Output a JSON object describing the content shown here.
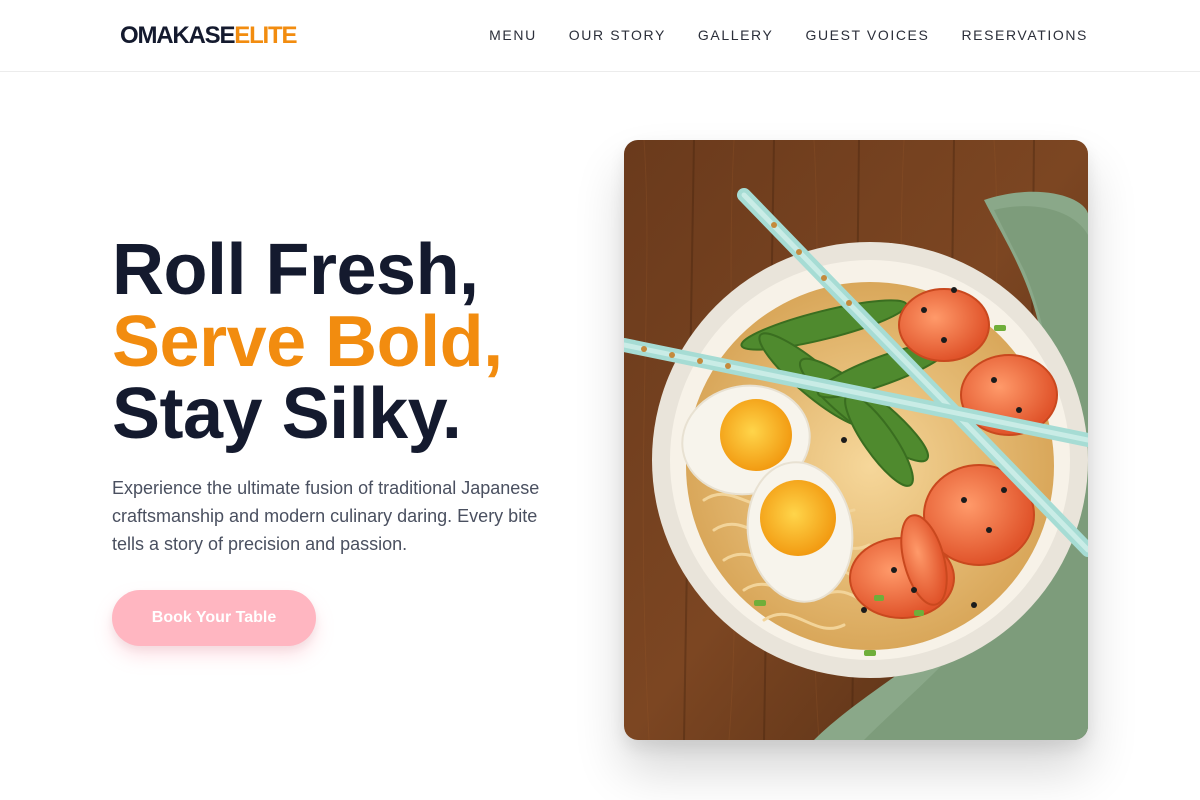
{
  "brand": {
    "name_part1": "OMAKASE",
    "name_part2": "ELITE",
    "primary_color": "#141a2e",
    "accent_color": "#f28c0f"
  },
  "nav": {
    "items": [
      {
        "label": "MENU"
      },
      {
        "label": "OUR STORY"
      },
      {
        "label": "GALLERY"
      },
      {
        "label": "GUEST VOICES"
      },
      {
        "label": "RESERVATIONS"
      }
    ]
  },
  "hero": {
    "title_line1": "Roll Fresh,",
    "title_line2": "Serve Bold,",
    "title_line3": "Stay Silky.",
    "description": "Experience the ultimate fusion of traditional Japanese craftsmanship and modern culinary daring. Every bite tells a story of precision and passion.",
    "cta_label": "Book Your Table",
    "cta_color": "#ffb6c1"
  }
}
